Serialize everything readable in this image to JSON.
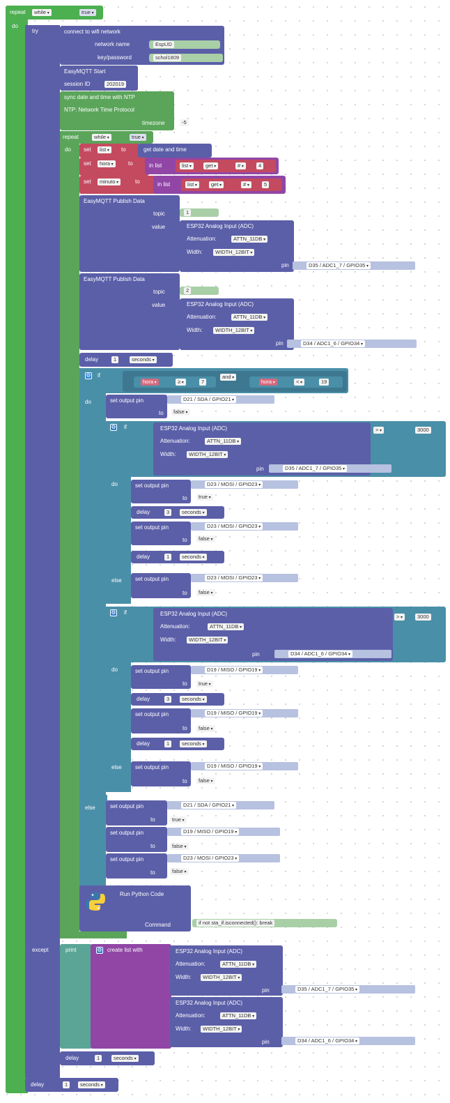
{
  "main": {
    "repeat_label": "repeat",
    "while_option": "while",
    "true_value": "true",
    "do_label": "do",
    "try_label": "try",
    "except_label": "except",
    "else_label": "else",
    "if_label": "if",
    "to_label": "to"
  },
  "wifi": {
    "title": "connect to wifi network",
    "network_name_label": "network name",
    "network_name": "EspUD",
    "key_label": "key/password",
    "key": "schol1809"
  },
  "mqtt_start": {
    "title": "EasyMQTT Start",
    "session_label": "session ID",
    "session_id": "202019"
  },
  "ntp": {
    "title": "sync date and time with NTP",
    "subtitle": "NTP: Network Time Protocol",
    "timezone_label": "timezone",
    "timezone": "-5"
  },
  "vars": {
    "set_label": "set",
    "list_var": "list",
    "get_date_label": "get date and time",
    "hora_var": "hora",
    "minuto_var": "minuto",
    "in_list_label": "in list",
    "get_option": "get",
    "index_mode": "#",
    "hora_index": "4",
    "minuto_index": "5"
  },
  "publish": {
    "title": "EasyMQTT Publish Data",
    "topic_label": "topic",
    "value_label": "value",
    "topic1": "1",
    "topic2": "2"
  },
  "adc": {
    "title": "ESP32 Analog Input (ADC)",
    "attenuation_label": "Attenuation:",
    "attenuation": "ATTN_11DB",
    "width_label": "Width:",
    "width": "WIDTH_12BIT",
    "pin_label": "pin",
    "pin35": "D35 / ADC1_7 / GPIO35",
    "pin34": "D34 / ADC1_6 / GPIO34"
  },
  "delay": {
    "label": "delay",
    "seconds": "seconds",
    "one": "1",
    "three": "3"
  },
  "logic": {
    "and_label": "and",
    "gte": "≥",
    "lt": "<",
    "gt": ">",
    "seven": "7",
    "nineteen": "19",
    "threshold": "3000"
  },
  "outputs": {
    "set_output_label": "set output pin",
    "pin_prefix": "pin",
    "d21": "D21 / SDA / GPIO21",
    "d23": "D23 / MOSI / GPIO23",
    "d19": "D19 / MISO / GPIO19",
    "true_val": "true",
    "false_val": "false"
  },
  "python": {
    "title": "Run Python Code",
    "command_label": "Command",
    "command": "if not sta_if.isconnected(): break"
  },
  "except_block": {
    "print_label": "print",
    "create_list_label": "create list with"
  }
}
